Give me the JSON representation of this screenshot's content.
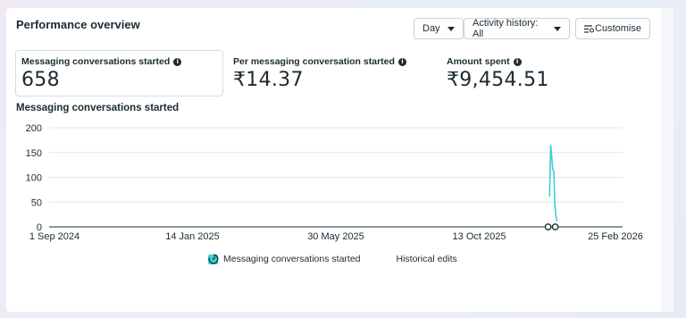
{
  "header": {
    "title": "Performance overview",
    "day_label": "Day",
    "activity_label": "Activity history: All",
    "customise_label": "Customise"
  },
  "metrics": [
    {
      "label": "Messaging conversations started",
      "value": "658"
    },
    {
      "label": "Per messaging conversation started",
      "value": "₹14.37"
    },
    {
      "label": "Amount spent",
      "value": "₹9,454.51"
    }
  ],
  "chart_title": "Messaging conversations started",
  "legend": {
    "series_label": "Messaging conversations started",
    "edits_label": "Historical edits"
  },
  "colors": {
    "series": "#3dcfd6",
    "grid": "#e3e6ea",
    "axis": "#1c2b33"
  },
  "chart_data": {
    "type": "line",
    "title": "Messaging conversations started",
    "xlabel": "",
    "ylabel": "",
    "x_range": [
      "2024-09-01",
      "2026-02-25"
    ],
    "x_ticks": [
      "1 Sep 2024",
      "14 Jan 2025",
      "30 May 2025",
      "13 Oct 2025",
      "25 Feb 2026"
    ],
    "ylim": [
      0,
      200
    ],
    "y_ticks": [
      0,
      50,
      100,
      150,
      200
    ],
    "grid": true,
    "legend_position": "bottom",
    "series": [
      {
        "name": "Messaging conversations started",
        "color": "#3dcfd6",
        "x": [
          "2025-12-18",
          "2025-12-19",
          "2025-12-20",
          "2025-12-21",
          "2025-12-22",
          "2025-12-23",
          "2025-12-24",
          "2025-12-25"
        ],
        "y": [
          62,
          165,
          145,
          115,
          112,
          45,
          22,
          12
        ]
      }
    ],
    "annotations": [
      {
        "type": "historical-edits",
        "x": "2025-12-20"
      }
    ]
  }
}
